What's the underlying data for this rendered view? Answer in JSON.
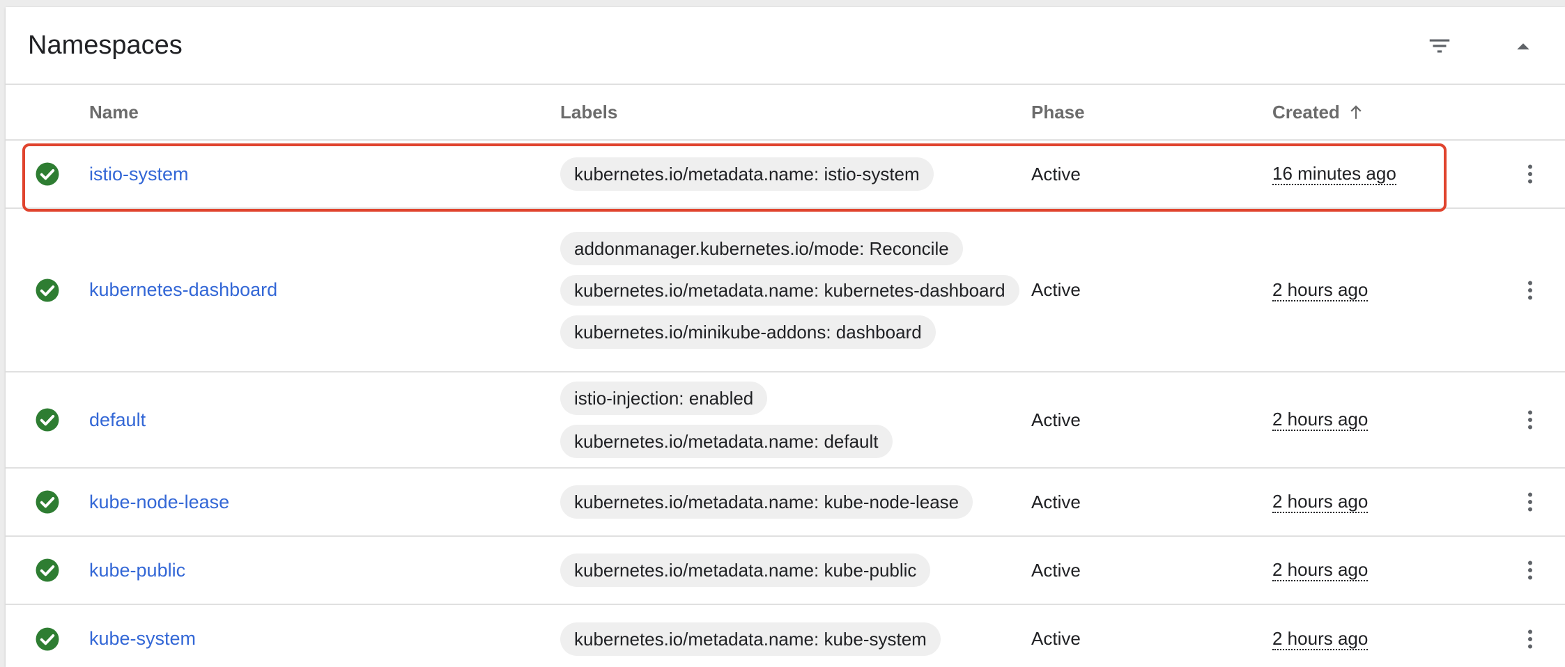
{
  "card": {
    "title": "Namespaces",
    "filter_icon": "filter-list-icon",
    "collapse_icon": "chevron-up-icon"
  },
  "columns": {
    "name": "Name",
    "labels": "Labels",
    "phase": "Phase",
    "created": "Created",
    "sort_icon": "arrow-up-icon"
  },
  "colors": {
    "link": "#3367d6",
    "status_ok": "#2e7d32",
    "highlight": "#e0442e",
    "chip_bg": "#efefef"
  },
  "rows": [
    {
      "status_icon": "check-circle-icon",
      "name": "istio-system",
      "labels": [
        "kubernetes.io/metadata.name: istio-system"
      ],
      "phase": "Active",
      "created": "16 minutes ago",
      "menu_icon": "more-vert-icon",
      "highlighted": true
    },
    {
      "status_icon": "check-circle-icon",
      "name": "kubernetes-dashboard",
      "labels": [
        "addonmanager.kubernetes.io/mode: Reconcile",
        "kubernetes.io/metadata.name: kubernetes-dashboard",
        "kubernetes.io/minikube-addons: dashboard"
      ],
      "phase": "Active",
      "created": "2 hours ago",
      "menu_icon": "more-vert-icon"
    },
    {
      "status_icon": "check-circle-icon",
      "name": "default",
      "labels": [
        "istio-injection: enabled",
        "kubernetes.io/metadata.name: default"
      ],
      "phase": "Active",
      "created": "2 hours ago",
      "menu_icon": "more-vert-icon"
    },
    {
      "status_icon": "check-circle-icon",
      "name": "kube-node-lease",
      "labels": [
        "kubernetes.io/metadata.name: kube-node-lease"
      ],
      "phase": "Active",
      "created": "2 hours ago",
      "menu_icon": "more-vert-icon"
    },
    {
      "status_icon": "check-circle-icon",
      "name": "kube-public",
      "labels": [
        "kubernetes.io/metadata.name: kube-public"
      ],
      "phase": "Active",
      "created": "2 hours ago",
      "menu_icon": "more-vert-icon"
    },
    {
      "status_icon": "check-circle-icon",
      "name": "kube-system",
      "labels": [
        "kubernetes.io/metadata.name: kube-system"
      ],
      "phase": "Active",
      "created": "2 hours ago",
      "menu_icon": "more-vert-icon"
    }
  ]
}
